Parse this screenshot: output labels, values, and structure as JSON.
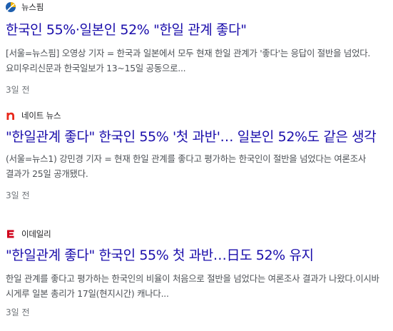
{
  "articles": [
    {
      "source": "뉴스핌",
      "source_icon": "newspim-logo-icon",
      "headline": "한국인 55%·일본인 52% \"한일 관계 좋다\"",
      "snippet": "[서울=뉴스핌] 오영상 기자 = 한국과 일본에서 모두 현재 한일 관계가 '좋다'는 응답이 절반을 넘었다. 요미우리신문과 한국일보가 13~15일 공동으로...",
      "time": "3일 전"
    },
    {
      "source": "네이트 뉴스",
      "source_icon": "nate-logo-icon",
      "headline": "\"한일관계 좋다\" 한국인 55% '첫 과반'… 일본인 52%도 같은 생각",
      "snippet": "(서울=뉴스1) 강민경 기자 = 현재 한일 관계를 좋다고 평가하는 한국인이 절반을 넘었다는 여론조사 결과가 25일 공개됐다.",
      "time": "3일 전"
    },
    {
      "source": "이데일리",
      "source_icon": "edaily-logo-icon",
      "headline": "\"한일관계 좋다\" 한국인 55% 첫 과반…日도 52% 유지",
      "snippet": "한일 관계를 좋다고 평가하는 한국인의 비율이 처음으로 절반을 넘었다는 여론조사 결과가 나왔다.이시바 시게루 일본 총리가 17일(현지시간) 캐나다...",
      "time": "3일 전"
    }
  ],
  "colors": {
    "headline": "#1a0dab",
    "snippet": "#4d5156",
    "time": "#70757a",
    "nate_red": "#e8281b",
    "edaily_red": "#d0021b",
    "newspim_blue": "#1f5fae",
    "newspim_yellow": "#f2b400"
  }
}
